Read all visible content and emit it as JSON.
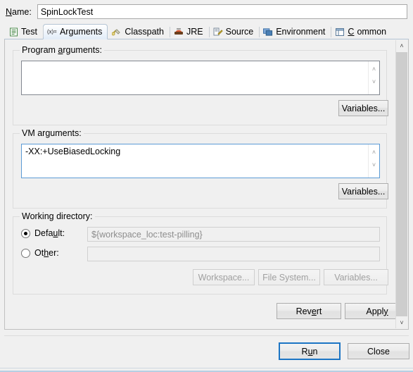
{
  "dialog": {
    "name_label_pre": "N",
    "name_label_post": "ame:",
    "name_value": "SpinLockTest"
  },
  "tabs": [
    {
      "label": "Test",
      "icon": "junit-test-icon",
      "selected": false
    },
    {
      "label": "Arguments",
      "icon": "arguments-variable-icon",
      "selected": true
    },
    {
      "label": "Classpath",
      "icon": "classpath-icon",
      "selected": false
    },
    {
      "label": "JRE",
      "icon": "jre-icon",
      "selected": false
    },
    {
      "label": "Source",
      "icon": "source-icon",
      "selected": false
    },
    {
      "label": "Environment",
      "icon": "environment-icon",
      "selected": false
    },
    {
      "label": "Common",
      "icon": "common-icon",
      "selected": false
    }
  ],
  "program_arguments": {
    "title_pre": "Program ",
    "title_mn": "a",
    "title_post": "rguments:",
    "value": "",
    "variables_button": "Variables..."
  },
  "vm_arguments": {
    "title": "VM arguments:",
    "value": "-XX:+UseBiasedLocking",
    "variables_button": "Variables..."
  },
  "working_directory": {
    "title": "Working directory:",
    "default_radio": {
      "label_pre": "Defa",
      "label_mn": "u",
      "label_post": "lt:",
      "checked": true,
      "value": "${workspace_loc:test-pilling}"
    },
    "other_radio": {
      "label_pre": "Ot",
      "label_mn": "h",
      "label_post": "er:",
      "checked": false,
      "value": ""
    },
    "workspace_button": "Workspace...",
    "filesystem_button": "File System...",
    "variables_button": "Variables..."
  },
  "actions": {
    "revert_pre": "Rev",
    "revert_mn": "e",
    "revert_post": "rt",
    "apply_pre": "Appl",
    "apply_mn": "y",
    "apply_post": "",
    "run_pre": "R",
    "run_mn": "u",
    "run_post": "n",
    "close": "Close"
  },
  "scroll": {
    "up_glyph": "˄",
    "down_glyph": "˅"
  },
  "colors": {
    "accent_focus": "#5b9bd5",
    "default_button_border": "#1c75c4",
    "tab_selected_bg": "#e3edf8",
    "dialog_bg": "#f0f0f0"
  }
}
